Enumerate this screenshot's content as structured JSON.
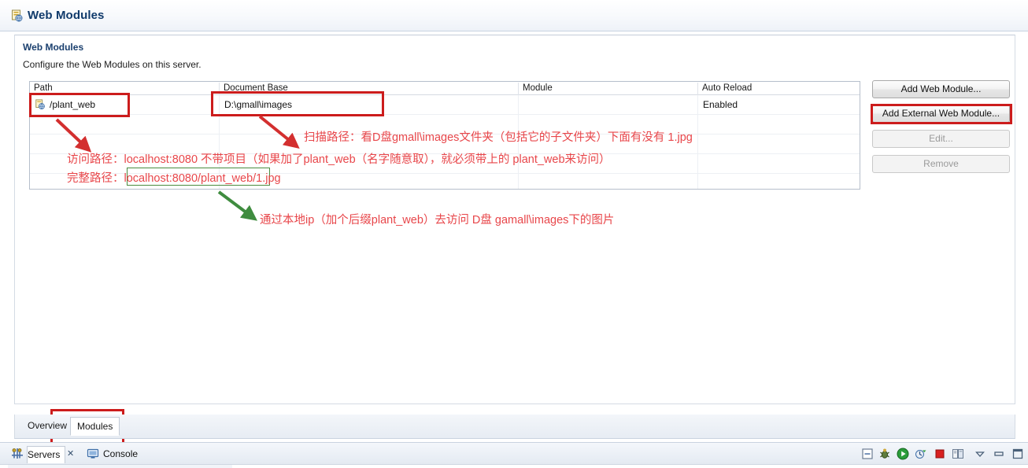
{
  "editor": {
    "title": "Web Modules",
    "title_icon": "web-module-icon"
  },
  "section": {
    "heading": "Web Modules",
    "description": "Configure the Web Modules on this server."
  },
  "table": {
    "columns": [
      "Path",
      "Document Base",
      "Module",
      "Auto Reload"
    ],
    "rows": [
      {
        "icon": "web-module-row-icon",
        "path": "/plant_web",
        "document_base": "D:\\gmall\\images",
        "module": "",
        "auto_reload": "Enabled"
      }
    ]
  },
  "buttons": {
    "add_web_module": "Add Web Module...",
    "add_external_web_module": "Add External Web Module...",
    "edit": "Edit...",
    "remove": "Remove"
  },
  "annotations": {
    "scan_path": "扫描路径：看D盘gmall\\images文件夹（包括它的子文件夹）下面有没有 1.jpg",
    "access_path": "访问路径：localhost:8080 不带项目（如果加了plant_web（名字随意取），就必须带上的 plant_web来访问）",
    "full_path": "完整路径：localhost:8080/plant_web/1.jpg",
    "bottom_note": "通过本地ip（加个后缀plant_web）去访问 D盘 gamall\\images下的图片"
  },
  "editor_tabs": [
    {
      "label": "Overview",
      "active": false
    },
    {
      "label": "Modules",
      "active": true
    }
  ],
  "view_tabs": [
    {
      "label": "Servers",
      "icon": "servers-icon",
      "active": true,
      "close": "✕"
    },
    {
      "label": "Console",
      "icon": "console-icon",
      "active": false
    }
  ],
  "view_toolbar": [
    "collapse-all-icon",
    "debug-icon",
    "run-icon",
    "profile-icon",
    "stop-icon",
    "publish-icon",
    "view-menu-icon",
    "minimize-icon",
    "maximize-icon"
  ],
  "colors": {
    "annotation_red": "#e8464a",
    "box_red": "#cc1c1c",
    "box_green": "#4a8c3f",
    "arrow_red": "#d32f2f",
    "arrow_green": "#3f8c3f",
    "title_blue": "#103a6b"
  }
}
